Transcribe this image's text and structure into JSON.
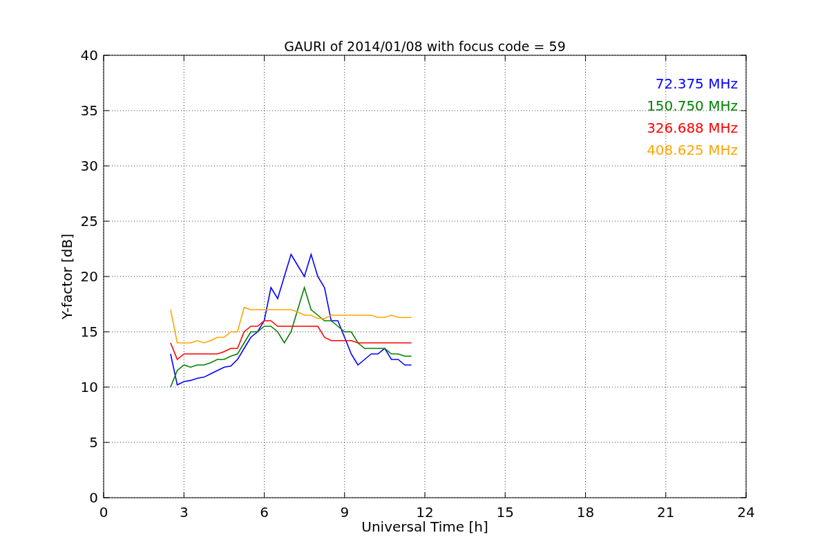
{
  "figure": {
    "chart_data": {
      "type": "line",
      "title": "GAURI of 2014/01/08 with focus code = 59",
      "xlabel": "Universal Time [h]",
      "ylabel": "Y-factor [dB]",
      "x": [
        2.5,
        2.75,
        3,
        3.25,
        3.5,
        3.75,
        4,
        4.25,
        4.5,
        4.75,
        5,
        5.25,
        5.5,
        5.75,
        6,
        6.25,
        6.5,
        6.75,
        7,
        7.25,
        7.5,
        7.75,
        8,
        8.25,
        8.5,
        8.75,
        9,
        9.25,
        9.5,
        9.75,
        10,
        10.25,
        10.5,
        10.75,
        11,
        11.25,
        11.5
      ],
      "series": [
        {
          "name": "72.375 MHz",
          "color": "#0000ff",
          "values": [
            13,
            10.2,
            10.5,
            10.6,
            10.8,
            10.9,
            11.2,
            11.5,
            11.8,
            11.9,
            12.5,
            13.5,
            14.5,
            15,
            16,
            19,
            18,
            20,
            22,
            21,
            20,
            22,
            20,
            19,
            16,
            16,
            14.5,
            13,
            12,
            12.5,
            13,
            13,
            13.5,
            12.5,
            12.5,
            12,
            12
          ]
        },
        {
          "name": "150.750 MHz",
          "color": "#008000",
          "values": [
            10,
            11.5,
            12,
            11.8,
            12,
            12,
            12.2,
            12.5,
            12.5,
            12.8,
            13,
            14,
            15,
            15,
            15.5,
            15.5,
            15,
            14,
            15,
            17,
            19,
            17,
            16.5,
            16,
            16,
            15.5,
            15,
            15,
            14,
            13.5,
            13.5,
            13.5,
            13.5,
            13,
            13,
            12.8,
            12.8
          ]
        },
        {
          "name": "326.688 MHz",
          "color": "#ff0000",
          "values": [
            14,
            12.5,
            13,
            13,
            13,
            13,
            13,
            13,
            13.2,
            13.5,
            13.5,
            15,
            15.5,
            15.5,
            16,
            16,
            15.5,
            15.5,
            15.5,
            15.5,
            15.5,
            15.5,
            15.5,
            14.5,
            14.2,
            14.2,
            14.2,
            14.2,
            14,
            14,
            14,
            14,
            14,
            14,
            14,
            14,
            14
          ]
        },
        {
          "name": "408.625 MHz",
          "color": "#ffa500",
          "values": [
            17,
            14,
            14,
            14,
            14.2,
            14,
            14.2,
            14.5,
            14.5,
            15,
            15,
            17.2,
            17,
            17,
            17,
            17,
            17,
            17,
            17,
            16.8,
            16.5,
            16.5,
            16.2,
            16.2,
            16.5,
            16.5,
            16.5,
            16.5,
            16.5,
            16.5,
            16.5,
            16.3,
            16.3,
            16.5,
            16.3,
            16.3,
            16.3
          ]
        }
      ],
      "xlim": [
        0,
        24
      ],
      "ylim": [
        0,
        40
      ],
      "xticks": [
        0,
        3,
        6,
        9,
        12,
        15,
        18,
        21,
        24
      ],
      "yticks": [
        0,
        5,
        10,
        15,
        20,
        25,
        30,
        35,
        40
      ],
      "grid": true
    }
  }
}
